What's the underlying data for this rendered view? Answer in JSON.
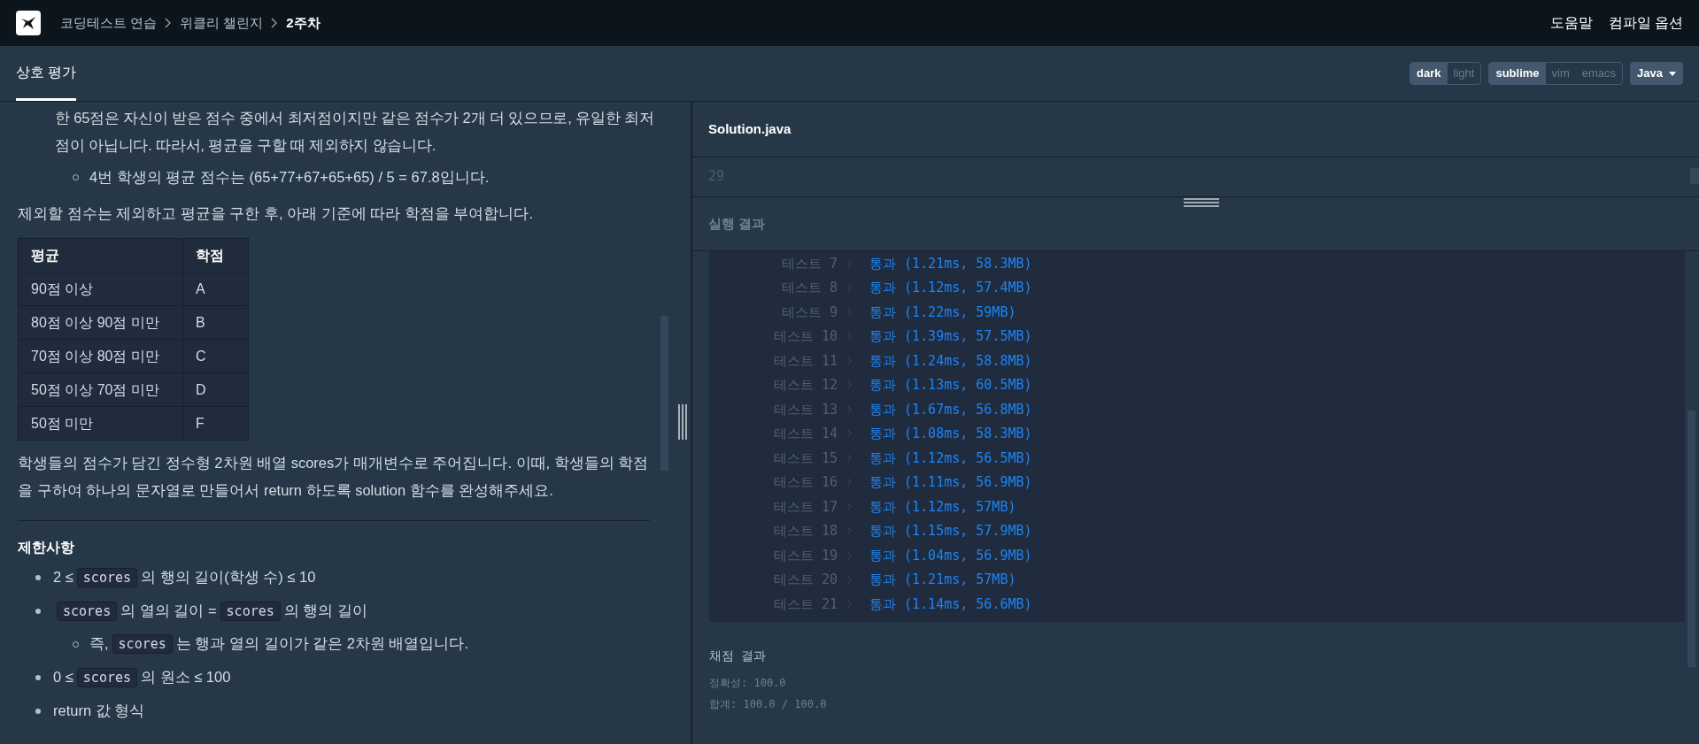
{
  "header": {
    "breadcrumbs": [
      {
        "label": "코딩테스트 연습",
        "current": false
      },
      {
        "label": "위클리 챌린지",
        "current": false
      },
      {
        "label": "2주차",
        "current": true
      }
    ],
    "links": [
      "도움말",
      "컴파일 옵션"
    ]
  },
  "tabs": [
    {
      "label": "상호 평가",
      "selected": true
    }
  ],
  "theme_toggle": [
    {
      "label": "dark",
      "selected": true
    },
    {
      "label": "light",
      "selected": false
    }
  ],
  "keymap_toggle": [
    {
      "label": "sublime",
      "selected": true
    },
    {
      "label": "vim",
      "selected": false
    },
    {
      "label": "emacs",
      "selected": false
    }
  ],
  "language_select": {
    "value": "Java"
  },
  "problem": [
    {
      "kind": "indented_paragraph",
      "text": "한 65점은 자신이 받은 점수 중에서 최저점이지만 같은 점수가 2개 더 있으므로, 유일한 최저점이 아닙니다. 따라서, 평균을 구할 때 제외하지 않습니다."
    },
    {
      "kind": "sub_bullet",
      "segments": [
        {
          "text": "4번 학생의 평균 점수는 (65+77+67+65+65) / 5 = 67.8입니다."
        }
      ]
    },
    {
      "kind": "paragraph",
      "text": "제외할 점수는 제외하고 평균을 구한 후, 아래 기준에 따라 학점을 부여합니다."
    },
    {
      "kind": "table",
      "columns": [
        "평균",
        "학점"
      ],
      "rows": [
        [
          "90점 이상",
          "A"
        ],
        [
          "80점 이상 90점 미만",
          "B"
        ],
        [
          "70점 이상 80점 미만",
          "C"
        ],
        [
          "50점 이상 70점 미만",
          "D"
        ],
        [
          "50점 미만",
          "F"
        ]
      ]
    },
    {
      "kind": "paragraph",
      "text": "학생들의 점수가 담긴 정수형 2차원 배열 scores가 매개변수로 주어집니다. 이때, 학생들의 학점을 구하여 하나의 문자열로 만들어서 return 하도록 solution 함수를 완성해주세요."
    },
    {
      "kind": "divider"
    },
    {
      "kind": "heading",
      "text": "제한사항"
    },
    {
      "kind": "bullet",
      "segments": [
        {
          "text": "2 ≤"
        },
        {
          "code": "scores"
        },
        {
          "text": "의 행의 길이(학생 수) ≤ 10"
        }
      ]
    },
    {
      "kind": "bullet",
      "segments": [
        {
          "code": "scores"
        },
        {
          "text": "의 열의 길이 ="
        },
        {
          "code": "scores"
        },
        {
          "text": "의 행의 길이"
        }
      ]
    },
    {
      "kind": "sub_bullet",
      "segments": [
        {
          "text": "즉,"
        },
        {
          "code": "scores"
        },
        {
          "text": "는 행과 열의 길이가 같은 2차원 배열입니다."
        }
      ]
    },
    {
      "kind": "bullet",
      "segments": [
        {
          "text": "0 ≤"
        },
        {
          "code": "scores"
        },
        {
          "text": "의 원소 ≤ 100"
        }
      ]
    },
    {
      "kind": "bullet",
      "segments": [
        {
          "text": "return 값 형식"
        }
      ]
    }
  ],
  "editor": {
    "filename": "Solution.java",
    "line_numbers": [
      "29"
    ]
  },
  "results": {
    "title": "실행 결과",
    "tests": [
      {
        "label": "테스트 7",
        "result": "통과 (1.21ms, 58.3MB)"
      },
      {
        "label": "테스트 8",
        "result": "통과 (1.12ms, 57.4MB)"
      },
      {
        "label": "테스트 9",
        "result": "통과 (1.22ms, 59MB)"
      },
      {
        "label": "테스트 10",
        "result": "통과 (1.39ms, 57.5MB)"
      },
      {
        "label": "테스트 11",
        "result": "통과 (1.24ms, 58.8MB)"
      },
      {
        "label": "테스트 12",
        "result": "통과 (1.13ms, 60.5MB)"
      },
      {
        "label": "테스트 13",
        "result": "통과 (1.67ms, 56.8MB)"
      },
      {
        "label": "테스트 14",
        "result": "통과 (1.08ms, 58.3MB)"
      },
      {
        "label": "테스트 15",
        "result": "통과 (1.12ms, 56.5MB)"
      },
      {
        "label": "테스트 16",
        "result": "통과 (1.11ms, 56.9MB)"
      },
      {
        "label": "테스트 17",
        "result": "통과 (1.12ms, 57MB)"
      },
      {
        "label": "테스트 18",
        "result": "통과 (1.15ms, 57.9MB)"
      },
      {
        "label": "테스트 19",
        "result": "통과 (1.04ms, 56.9MB)"
      },
      {
        "label": "테스트 20",
        "result": "통과 (1.21ms, 57MB)"
      },
      {
        "label": "테스트 21",
        "result": "통과 (1.14ms, 56.6MB)"
      }
    ],
    "grading": {
      "title": "채점 결과",
      "lines": [
        "정확성: 100.0",
        "합계: 100.0 / 100.0"
      ]
    }
  }
}
